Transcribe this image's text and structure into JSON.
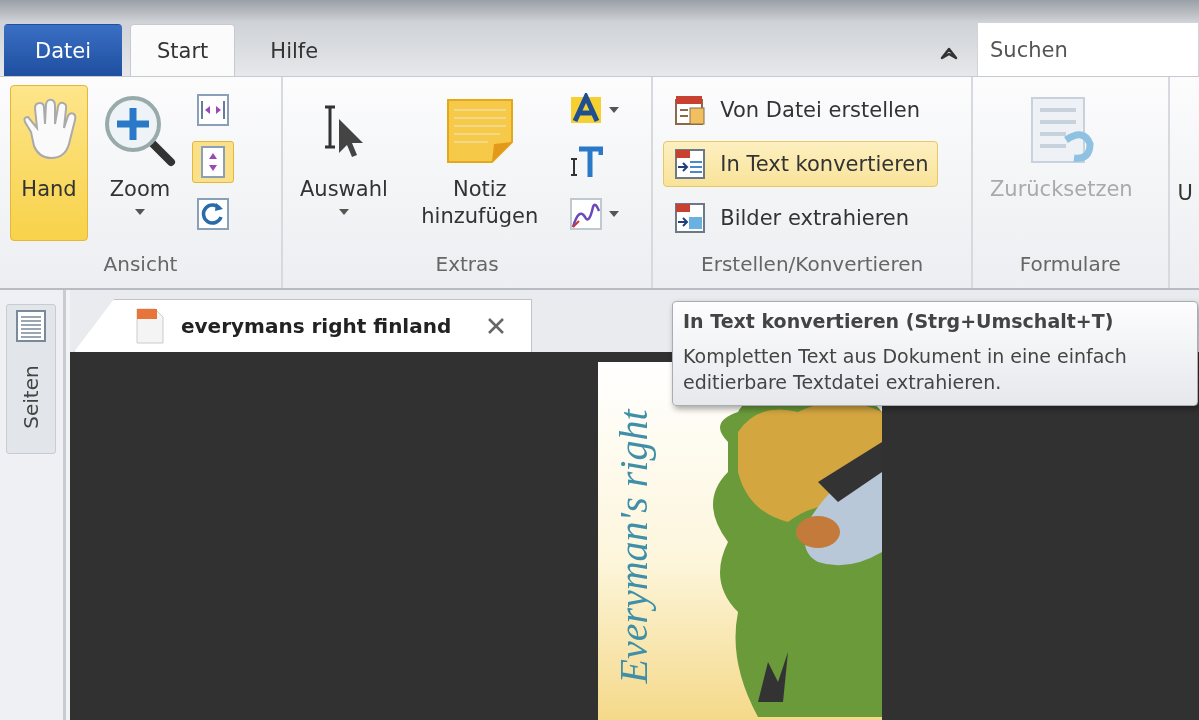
{
  "menu_tabs": [
    {
      "label": "Datei",
      "kind": "file",
      "selected": false
    },
    {
      "label": "Start",
      "kind": "tab",
      "selected": true
    },
    {
      "label": "Hilfe",
      "kind": "tab",
      "selected": false
    }
  ],
  "search": {
    "placeholder": "Suchen"
  },
  "ribbon": {
    "groups": [
      {
        "label": "Ansicht",
        "large": [
          {
            "label": "Hand",
            "selected": true,
            "dropdown": false,
            "disabled": false
          },
          {
            "label": "Zoom",
            "selected": false,
            "dropdown": true,
            "disabled": false
          }
        ],
        "small": [
          {
            "selected": false,
            "dropdown": false
          },
          {
            "selected": true,
            "dropdown": false
          },
          {
            "selected": false,
            "dropdown": false
          }
        ]
      },
      {
        "label": "Extras",
        "large": [
          {
            "label": "Auswahl",
            "selected": false,
            "dropdown": true,
            "disabled": false
          },
          {
            "label": "Notiz hinzufügen",
            "selected": false,
            "dropdown": false,
            "disabled": false
          }
        ],
        "small": [
          {
            "selected": false,
            "dropdown": true
          },
          {
            "selected": false,
            "dropdown": false
          },
          {
            "selected": false,
            "dropdown": true
          }
        ]
      },
      {
        "label": "Erstellen/Konvertieren",
        "rows": [
          {
            "label": "Von Datei erstellen",
            "highlighted": false
          },
          {
            "label": "In Text konvertieren",
            "highlighted": true
          },
          {
            "label": "Bilder extrahieren",
            "highlighted": false
          }
        ]
      },
      {
        "label": "Formulare",
        "large": [
          {
            "label": "Zurücksetzen",
            "selected": false,
            "dropdown": false,
            "disabled": true
          }
        ]
      }
    ],
    "cut_button": {
      "label": "U"
    }
  },
  "sidebar": {
    "tabs": [
      {
        "label": "Seiten",
        "selected": false
      }
    ]
  },
  "document_tabs": [
    {
      "label": "everymans right finland",
      "selected": true
    }
  ],
  "tooltip": {
    "title": "In Text konvertieren (Strg+Umschalt+T)",
    "text": "Kompletten Text aus Dokument in eine einfach editierbare Textdatei extrahieren."
  },
  "document_page": {
    "title": "Everyman's right"
  }
}
